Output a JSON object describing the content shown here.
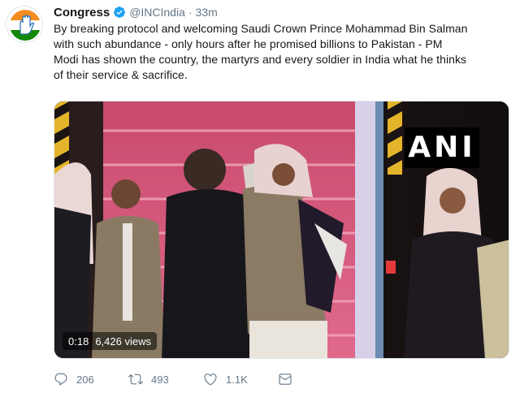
{
  "tweet": {
    "display_name": "Congress",
    "handle": "@INCIndia",
    "separator": "·",
    "time": "33m",
    "text_lines": [
      "By breaking protocol and welcoming Saudi Crown Prince Mohammad Bin Salman",
      "with such abundance - only hours after he promised billions to Pakistan - PM",
      "Modi has shown the country, the martyrs and every soldier in India what he thinks",
      "of their service & sacrifice."
    ]
  },
  "media": {
    "watermark": "ANI",
    "duration": "0:18",
    "views": "6,426 views"
  },
  "actions": {
    "reply_count": "206",
    "retweet_count": "493",
    "like_count": "1.1K"
  },
  "colors": {
    "text": "#14171a",
    "secondary": "#657786",
    "verified": "#1da1f2",
    "carpet": "#d9557d"
  },
  "icons": {
    "avatar": "congress-hand-logo",
    "verified": "verified-badge-icon",
    "reply": "reply-icon",
    "retweet": "retweet-icon",
    "like": "heart-icon",
    "message": "envelope-icon"
  }
}
